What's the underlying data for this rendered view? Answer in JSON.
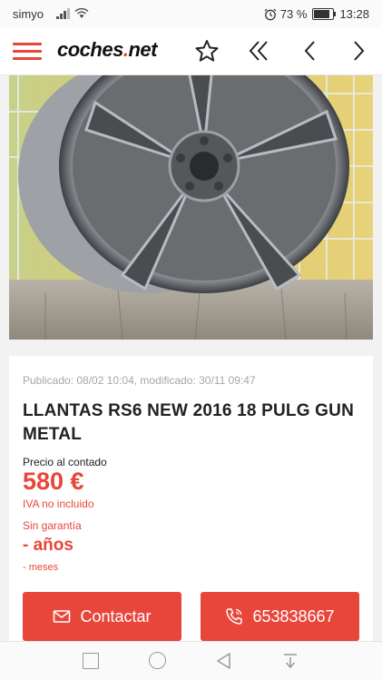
{
  "status_bar": {
    "carrier": "simyo",
    "battery": "73 %",
    "battery_level": 0.73,
    "time": "13:28"
  },
  "header": {
    "logo_main": "coches",
    "logo_dot": ".",
    "logo_tld": "net",
    "icons": [
      "menu-icon",
      "star-icon",
      "first-page-icon",
      "previous-icon",
      "next-icon"
    ]
  },
  "listing": {
    "published": "Publicado: 08/02 10:04, modificado: 30/11 09:47",
    "title": "LLANTAS RS6 NEW 2016 18 PULG GUN METAL",
    "price_label": "Precio al contado",
    "price": "580 €",
    "vat": "IVA no incluido",
    "warranty_label": "Sin garantía",
    "warranty_years": "- años",
    "warranty_months": "- meses"
  },
  "actions": {
    "contact_label": "Contactar",
    "phone_label": "653838667",
    "contact_icon": "mail-icon",
    "phone_icon": "phone-icon"
  },
  "colors": {
    "accent": "#e8463a",
    "card_bg": "#ffffff",
    "page_bg": "#f2f2f2"
  }
}
